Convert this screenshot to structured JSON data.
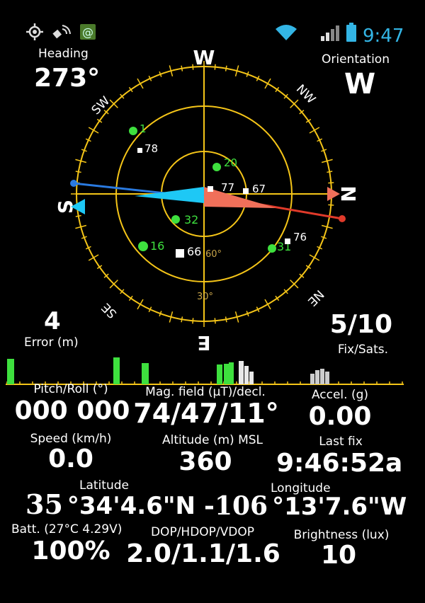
{
  "status_bar": {
    "time": "9:47",
    "icons": [
      "gps-target-icon",
      "satellite-icon",
      "app-notification-icon",
      "wifi-icon",
      "signal-icon",
      "battery-icon"
    ],
    "accent_color": "#33b5e5"
  },
  "heading": {
    "label": "Heading",
    "value": "273°"
  },
  "orientation": {
    "label": "Orientation",
    "value": "W"
  },
  "compass": {
    "ring_color": "#f5c518",
    "cardinals": {
      "top": "W",
      "right": "N",
      "bottom": "E",
      "left": "S"
    },
    "intercardinals": {
      "top_left": "SW",
      "top_right": "NW",
      "bottom_left": "SE",
      "bottom_right": "NE"
    },
    "elevation_labels": [
      "60°",
      "30°"
    ],
    "satellites": [
      {
        "id": "1",
        "type": "green-circle"
      },
      {
        "id": "78",
        "type": "white-square"
      },
      {
        "id": "20",
        "type": "green-circle"
      },
      {
        "id": "77",
        "type": "white-square"
      },
      {
        "id": "67",
        "type": "white-square"
      },
      {
        "id": "32",
        "type": "green-circle"
      },
      {
        "id": "16",
        "type": "green-circle"
      },
      {
        "id": "66",
        "type": "white-square"
      },
      {
        "id": "31",
        "type": "green-circle"
      },
      {
        "id": "76",
        "type": "white-square"
      }
    ]
  },
  "error": {
    "value": "4",
    "label": "Error (m)"
  },
  "fix_sats": {
    "value": "5/10",
    "label": "Fix/Sats."
  },
  "metrics": {
    "pitch_roll": {
      "label": "Pitch/Roll (°)",
      "value": "000 000"
    },
    "mag_field": {
      "label": "Mag. field (µT)/decl.",
      "value": "74/47/11°"
    },
    "accel": {
      "label": "Accel. (g)",
      "value": "0.00"
    },
    "speed": {
      "label": "Speed (km/h)",
      "value": "0.0"
    },
    "altitude": {
      "label": "Altitude (m) MSL",
      "value": "360"
    },
    "last_fix": {
      "label": "Last fix",
      "value": "9:46:52a"
    },
    "latitude": {
      "label": "Latitude",
      "degrees": "35",
      "rest": "°34'4.6\"N"
    },
    "longitude": {
      "label": "Longitude",
      "degrees": "-106",
      "rest": "°13'7.6\"W"
    },
    "battery": {
      "label": "Batt. (27°C 4.29V)",
      "value": "100%"
    },
    "dop": {
      "label": "DOP/HDOP/VDOP",
      "value": "2.0/1.1/1.6"
    },
    "brightness": {
      "label": "Brightness (lux)",
      "value": "10"
    }
  }
}
